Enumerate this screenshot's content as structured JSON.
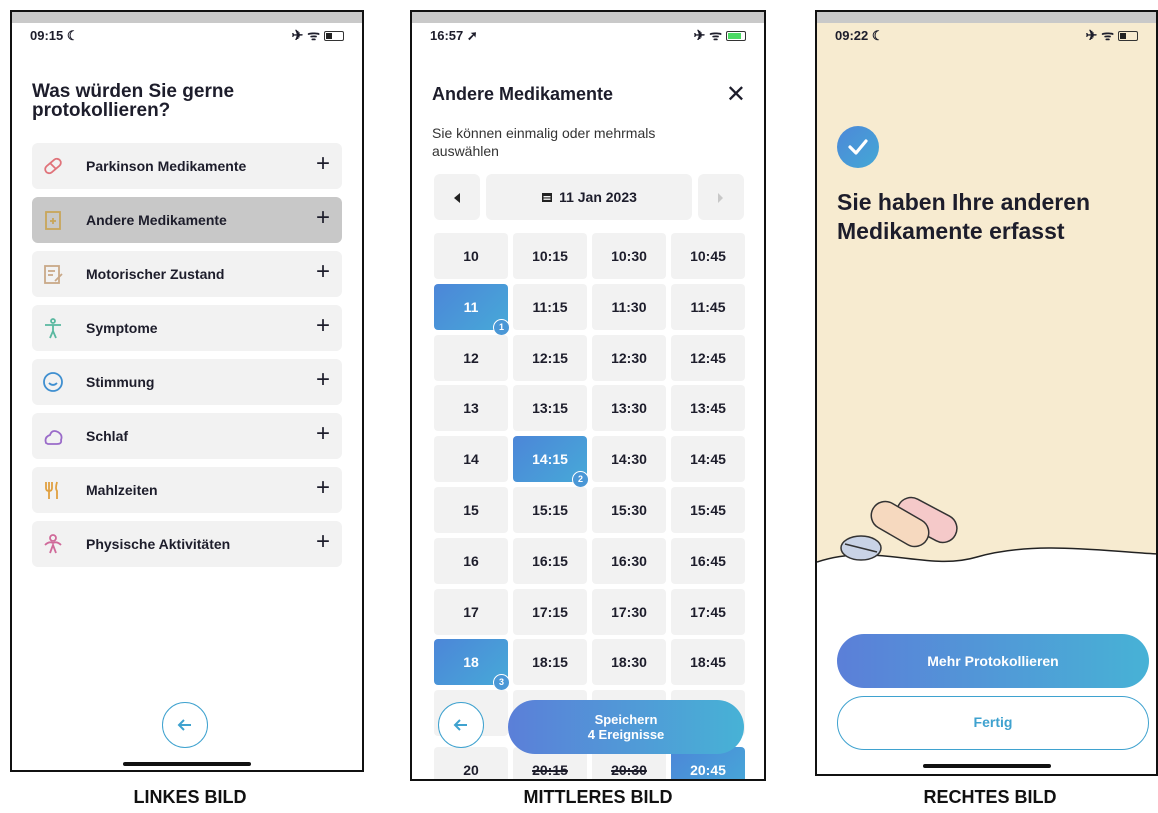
{
  "left": {
    "caption": "LINKES BILD",
    "status_time": "09:15 ☾",
    "status_icons": "✈ ᯤ",
    "title": "Was würden Sie gerne protokollieren?",
    "items": [
      {
        "label": "Parkinson Medikamente",
        "icon": "pill-icon",
        "color": "#e0737a"
      },
      {
        "label": "Andere Medikamente",
        "icon": "medicine-box-icon",
        "color": "#c9a65a"
      },
      {
        "label": "Motorischer Zustand",
        "icon": "clipboard-edit-icon",
        "color": "#c9a888"
      },
      {
        "label": "Symptome",
        "icon": "person-icon",
        "color": "#5ab8a0"
      },
      {
        "label": "Stimmung",
        "icon": "mood-face-icon",
        "color": "#3f8fd0"
      },
      {
        "label": "Schlaf",
        "icon": "moon-cloud-icon",
        "color": "#9a6bc9"
      },
      {
        "label": "Mahlzeiten",
        "icon": "fork-knife-icon",
        "color": "#e0a040"
      },
      {
        "label": "Physische Aktivitäten",
        "icon": "activity-icon",
        "color": "#d06a9a"
      }
    ],
    "plus": "+",
    "selected_index": 1
  },
  "middle": {
    "caption": "MITTLERES BILD",
    "status_time": "16:57 ➚",
    "status_icons": "✈ ᯤ",
    "title": "Andere Medikamente",
    "close": "✕",
    "subtitle": "Sie können einmalig oder mehrmals auswählen",
    "date": "11 Jan 2023",
    "rows": [
      [
        "10",
        "10:15",
        "10:30",
        "10:45"
      ],
      [
        "11",
        "11:15",
        "11:30",
        "11:45"
      ],
      [
        "12",
        "12:15",
        "12:30",
        "12:45"
      ],
      [
        "13",
        "13:15",
        "13:30",
        "13:45"
      ],
      [
        "14",
        "14:15",
        "14:30",
        "14:45"
      ],
      [
        "15",
        "15:15",
        "15:30",
        "15:45"
      ],
      [
        "16",
        "16:15",
        "16:30",
        "16:45"
      ],
      [
        "17",
        "17:15",
        "17:30",
        "17:45"
      ],
      [
        "18",
        "18:15",
        "18:30",
        "18:45"
      ],
      [
        "20",
        "20:15",
        "20:30",
        "20:45"
      ]
    ],
    "selected": [
      {
        "time": "11",
        "badge": "1"
      },
      {
        "time": "14:15",
        "badge": "2"
      },
      {
        "time": "18",
        "badge": "3"
      },
      {
        "time": "20:45",
        "badge": ""
      }
    ],
    "struck": [
      "20:15",
      "20:30"
    ],
    "save_line1": "Speichern",
    "save_line2": "4 Ereignisse"
  },
  "right": {
    "caption": "RECHTES BILD",
    "status_time": "09:22 ☾",
    "status_icons": "✈ ᯤ",
    "title": "Sie haben Ihre anderen Medikamente erfasst",
    "primary_button": "Mehr Protokollieren",
    "secondary_button": "Fertig",
    "background_color": "#f7ebd0"
  }
}
